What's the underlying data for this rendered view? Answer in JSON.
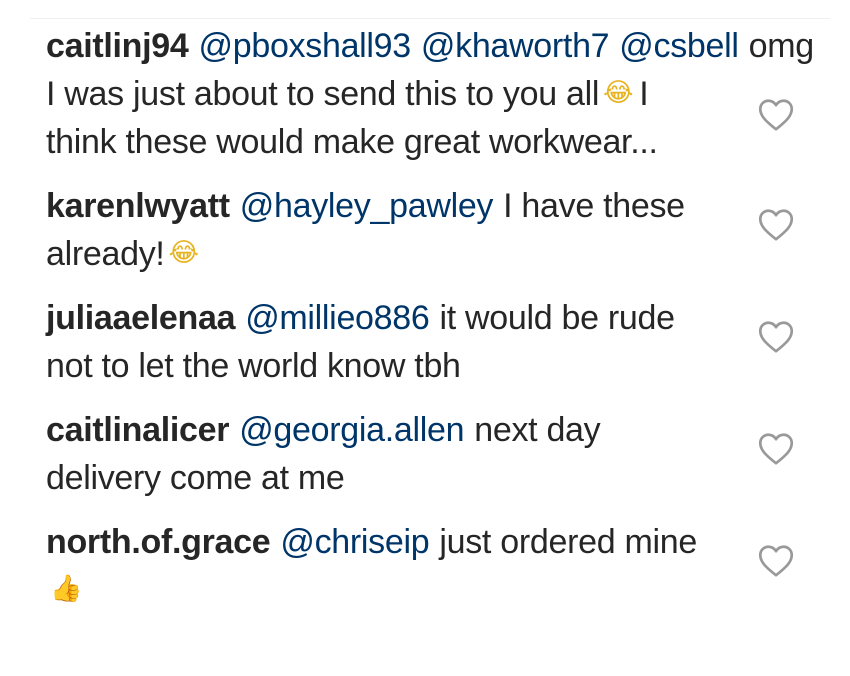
{
  "comments": [
    {
      "username": "caitlinj94",
      "mentions": [
        "@pboxshall93",
        "@khaworth7",
        "@csbell"
      ],
      "text_before": "omg I was just about to send this to you all",
      "emoji": "face-with-tears-of-joy-icon",
      "emoji_glyph": "😂",
      "text_after": "I think these would make great workwear..."
    },
    {
      "username": "karenlwyatt",
      "mentions": [
        "@hayley_pawley"
      ],
      "text_before": "I have these already!",
      "emoji": "face-with-tears-of-joy-icon",
      "emoji_glyph": "😂",
      "text_after": ""
    },
    {
      "username": "juliaaelenaa",
      "mentions": [
        "@millieo886"
      ],
      "text_before": "it would be rude not to let the world know tbh",
      "emoji": "",
      "emoji_glyph": "",
      "text_after": ""
    },
    {
      "username": "caitlinalicer",
      "mentions": [
        "@georgia.allen"
      ],
      "text_before": "next day delivery come at me",
      "emoji": "",
      "emoji_glyph": "",
      "text_after": ""
    },
    {
      "username": "north.of.grace",
      "mentions": [
        "@chriseip"
      ],
      "text_before": "just ordered mine",
      "emoji": "thumbs-up-icon",
      "emoji_glyph": "👍",
      "text_after": ""
    }
  ],
  "colors": {
    "username": "#262626",
    "mention": "#003569",
    "text": "#262626",
    "heart_outline": "#999999"
  },
  "like_icon": "heart-outline-icon"
}
